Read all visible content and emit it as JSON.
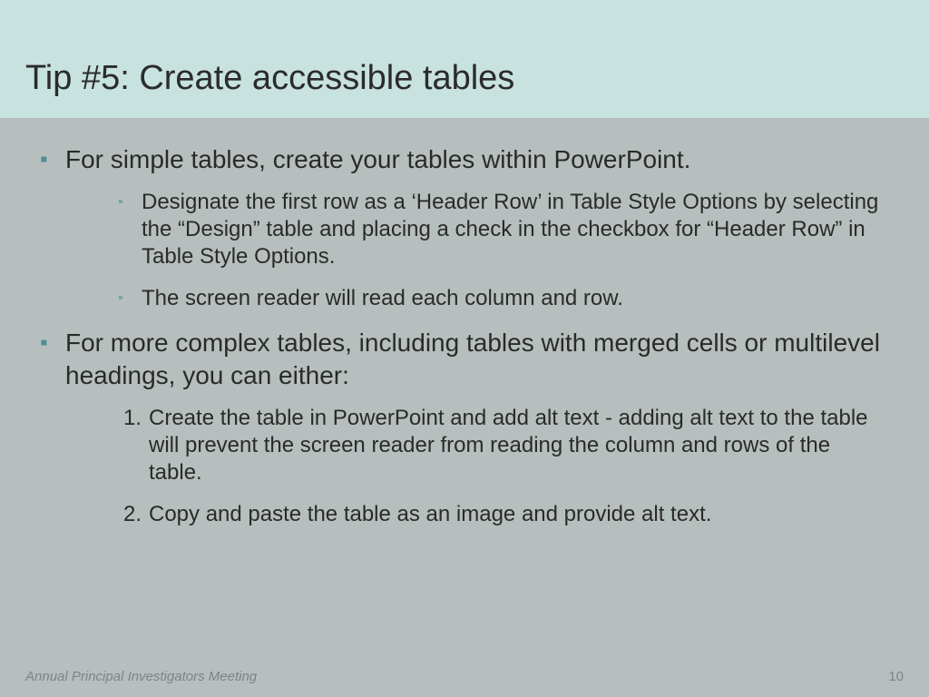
{
  "title": "Tip #5: Create accessible tables",
  "bullets": {
    "b1": "For simple tables, create your tables within PowerPoint.",
    "b1a": "Designate the first row as a ‘Header Row’ in Table Style Options by selecting the “Design” table and placing a check in the checkbox for “Header Row” in Table Style Options.",
    "b1b": "The screen reader will read each column and row.",
    "b2": "For more complex tables, including tables with merged cells or multilevel headings, you can either:",
    "n1_label": "1.",
    "n1": "Create the table in PowerPoint and add alt text - adding alt text to the table will prevent the  screen reader from reading the column and rows of the table.",
    "n2_label": "2.",
    "n2": "Copy and paste the table as an image and provide alt text."
  },
  "footer": {
    "left": "Annual Principal Investigators Meeting",
    "page": "10"
  },
  "colors": {
    "header_bg": "#c7e2df",
    "body_bg": "#b7bfbe",
    "bullet": "#4e8e94"
  }
}
